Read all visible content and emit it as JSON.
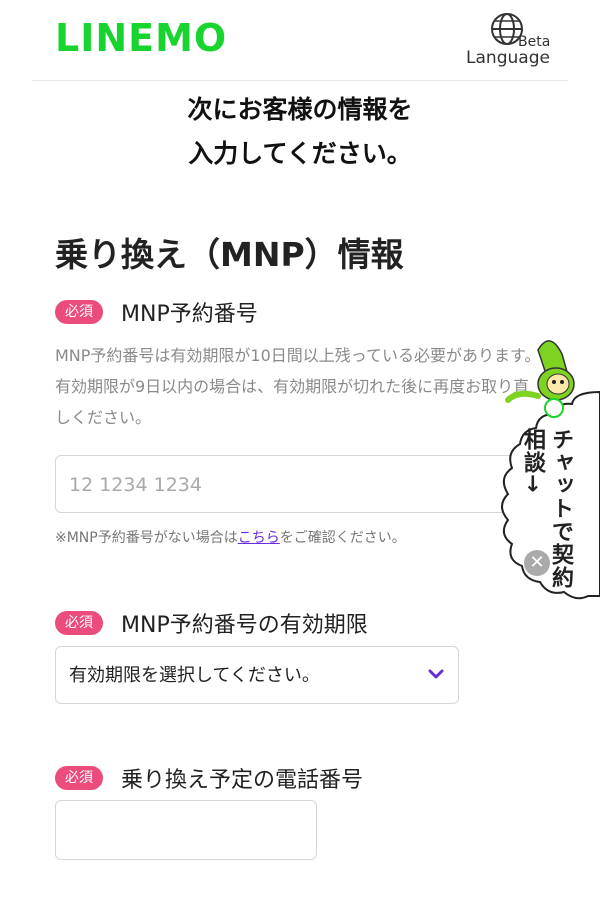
{
  "header": {
    "logo_text": "LINEMO",
    "beta": "Beta",
    "language": "Language"
  },
  "intro": {
    "line1": "次にお客様の情報を",
    "line2": "入力してください。"
  },
  "section": {
    "title": "乗り換え（MNP）情報"
  },
  "required_badge": "必須",
  "mnp_number": {
    "label": "MNP予約番号",
    "description": "MNP予約番号は有効期限が10日間以上残っている必要があります。有効期限が9日以内の場合は、有効期限が切れた後に再度お取り直しください。",
    "placeholder": "12 1234 1234",
    "note_prefix": "※MNP予約番号がない場合は",
    "note_link": "こちら",
    "note_suffix": "をご確認ください。"
  },
  "expiry": {
    "label": "MNP予約番号の有効期限",
    "select_value": "有効期限を選択してください。"
  },
  "phone": {
    "label": "乗り換え予定の電話番号",
    "value": ""
  },
  "chat": {
    "text": "チャットで契約相談→",
    "close_icon": "close-icon"
  },
  "colors": {
    "brand_green": "#18d42e",
    "required_pink": "#ec4c7c",
    "link_purple": "#6a2bd8",
    "chevron_purple": "#6a2bd8"
  }
}
